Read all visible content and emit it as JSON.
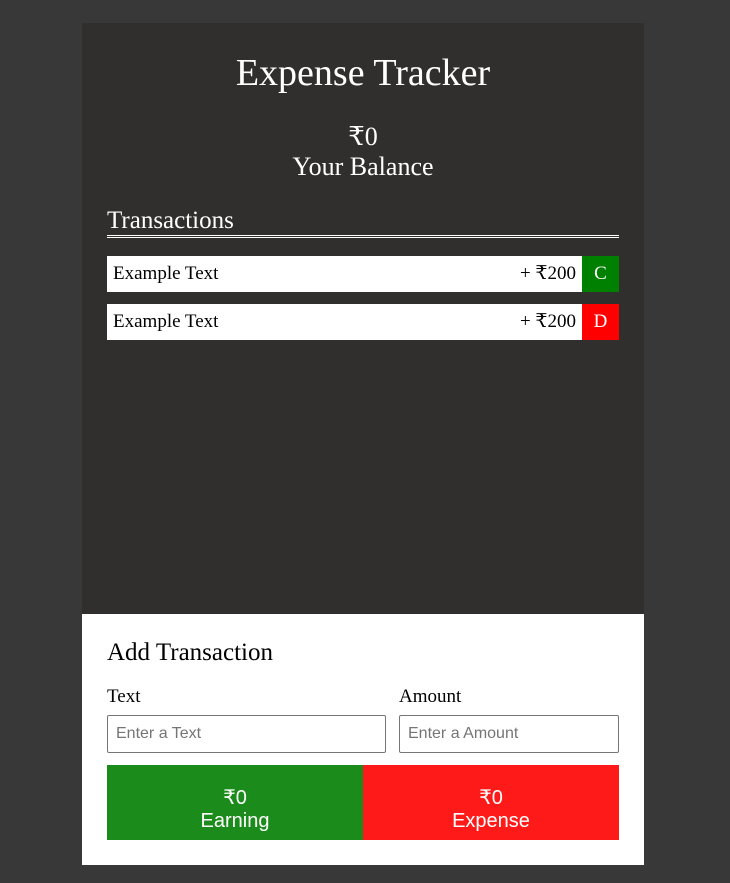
{
  "app": {
    "title": "Expense Tracker",
    "balance_amount": "₹0",
    "balance_label": "Your Balance"
  },
  "transactions": {
    "heading": "Transactions",
    "items": [
      {
        "text": "Example Text",
        "amount": "+ ₹200",
        "badge": "C",
        "badge_color": "#008000"
      },
      {
        "text": "Example Text",
        "amount": "+ ₹200",
        "badge": "D",
        "badge_color": "#ff0000"
      }
    ]
  },
  "add_transaction": {
    "heading": "Add Transaction",
    "text_label": "Text",
    "text_placeholder": "Enter a Text",
    "amount_label": "Amount",
    "amount_placeholder": "Enter a Amount",
    "earning": {
      "amount": "₹0",
      "label": "Earning",
      "color": "#1b8c1b"
    },
    "expense": {
      "amount": "₹0",
      "label": "Expense",
      "color": "#ff1a1a"
    }
  }
}
